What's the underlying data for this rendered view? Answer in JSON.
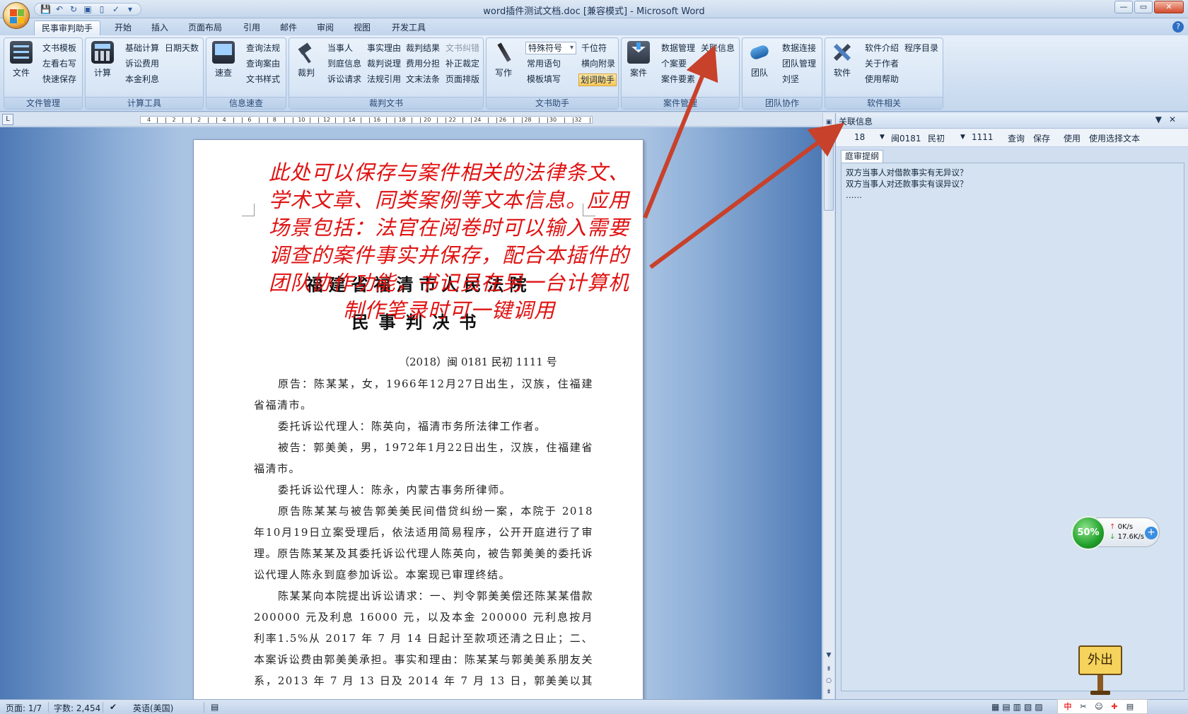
{
  "window": {
    "title": "word插件测试文档.doc [兼容模式] - Microsoft Word",
    "controls": {
      "min": "—",
      "max": "▭",
      "close": "✕"
    },
    "help": "?"
  },
  "ribbon_tabs": [
    "民事审判助手",
    "开始",
    "插入",
    "页面布局",
    "引用",
    "邮件",
    "审阅",
    "视图",
    "开发工具"
  ],
  "ribbon": {
    "file_mgmt": {
      "label": "文件管理",
      "big": "文件",
      "items": [
        "文书模板",
        "左看右写",
        "快速保存"
      ]
    },
    "calc": {
      "label": "计算工具",
      "big": "计算",
      "items": [
        "基础计算",
        "日期天数",
        "诉讼费用",
        "本金利息"
      ]
    },
    "info": {
      "label": "信息速查",
      "big": "速查",
      "items": [
        "查询法规",
        "查询案由",
        "文书样式"
      ]
    },
    "judge": {
      "label": "裁判文书",
      "big": "裁判",
      "items": [
        "当事人",
        "事实理由",
        "裁判结果",
        "文书纠错",
        "到庭信息",
        "裁判说理",
        "费用分担",
        "补正裁定",
        "诉讼请求",
        "法规引用",
        "文末法条",
        "页面排版"
      ]
    },
    "writing": {
      "label": "文书助手",
      "big": "写作",
      "combo": "特殊符号",
      "items": [
        "千位符",
        "常用语句",
        "横向附录",
        "模板填写",
        "划词助手"
      ]
    },
    "case": {
      "label": "案件管理",
      "big": "案件",
      "items": [
        "数据管理",
        "关联信息",
        "个案要",
        "案件要素"
      ]
    },
    "team": {
      "label": "团队协作",
      "big": "团队",
      "items": [
        "数据连接",
        "团队管理",
        "刘坚"
      ]
    },
    "software": {
      "label": "软件相关",
      "big": "软件",
      "items": [
        "软件介绍",
        "程序目录",
        "关于作者",
        "使用帮助"
      ]
    }
  },
  "ruler": {
    "labels": [
      "4",
      "2",
      "2",
      "4",
      "6",
      "8",
      "10",
      "12",
      "14",
      "16",
      "18",
      "20",
      "22",
      "24",
      "26",
      "28",
      "30",
      "32"
    ]
  },
  "document": {
    "court": "福建省福清市人民法院",
    "doc_type": "民事判决书",
    "case_no": "（2018）闽 0181 民初 1111 号",
    "paragraphs": [
      "原告：陈某某，女，1966年12月27日出生，汉族，住福建省福清市。",
      "委托诉讼代理人：陈英向，福清市务所法律工作者。",
      "被告：郭美美，男，1972年1月22日出生，汉族，住福建省福清市。",
      "委托诉讼代理人：陈永，内蒙古事务所律师。",
      "原告陈某某与被告郭美美民间借贷纠纷一案，本院于 2018 年10月19日立案受理后，依法适用简易程序，公开开庭进行了审理。原告陈某某及其委托诉讼代理人陈英向，被告郭美美的委托诉讼代理人陈永到庭参加诉讼。本案现已审理终结。",
      "陈某某向本院提出诉讼请求：一、判令郭美美偿还陈某某借款 200000 元及利息 16000 元，以及本金 200000 元利息按月利率1.5%从 2017 年 7 月 14 日起计至款项还清之日止；二、本案诉讼费由郭美美承担。事实和理由：陈某某与郭美美系朋友关系，2013 年 7 月 13 日及 2014 年 7 月 13 日，郭美美以其开办的公司缺乏资"
    ],
    "annotation": "此处可以保存与案件相关的法律条文、学术文章、同类案例等文本信息。应用场景包括：法官在阅卷时可以输入需要调查的案件事实并保存，配合本插件的团队协作功能，书记员在另一台计算机制作笔录时可一键调用"
  },
  "panel": {
    "title": "关联信息",
    "toolbar": {
      "year": "18",
      "region": "闽0181",
      "type": "民初",
      "number": "1111",
      "buttons": [
        "查询",
        "保存",
        "使用",
        "使用选择文本"
      ]
    },
    "tab": "庭审提纲",
    "lines": [
      "双方当事人对借款事实有无异议？",
      "双方当事人对还款事实有误异议？",
      "……"
    ]
  },
  "net_widget": {
    "percent": "50%",
    "up": "0K/s",
    "down": "17.6K/s"
  },
  "signpost": "外出",
  "status": {
    "page": "页面: 1/7",
    "words": "字数: 2,454",
    "lang": "英语(美国)"
  },
  "ime": [
    "中",
    "✂",
    "☺",
    "✚",
    "▤"
  ],
  "colors": {
    "annotation": "#e01212",
    "arrow": "#c8412b",
    "ribbon_bg": "#d1e0f2"
  }
}
